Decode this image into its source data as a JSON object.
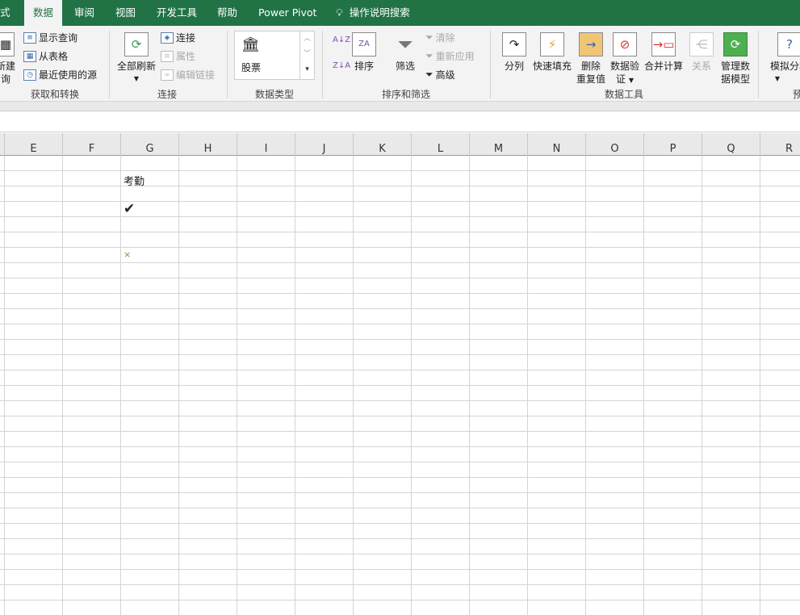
{
  "tabs": [
    {
      "label": "式"
    },
    {
      "label": "数据",
      "active": true
    },
    {
      "label": "审阅"
    },
    {
      "label": "视图"
    },
    {
      "label": "开发工具"
    },
    {
      "label": "帮助"
    },
    {
      "label": "Power Pivot"
    },
    {
      "label": "操作说明搜索",
      "icon": "lightbulb-icon"
    }
  ],
  "colors": {
    "accent": "#217346",
    "ribbon": "#f3f3f3"
  },
  "groups": {
    "get": {
      "label": "获取和转换",
      "new_query": "新建\n询",
      "show_query": "显示查询",
      "from_table": "从表格",
      "recent_sources": "最近使用的源"
    },
    "conn": {
      "label": "连接",
      "refresh_all": "全部刷新",
      "connections": "连接",
      "properties": "属性",
      "edit_links": "编辑链接"
    },
    "dtype": {
      "label": "数据类型",
      "stock": "股票"
    },
    "sort": {
      "label": "排序和筛选",
      "sort": "排序",
      "filter": "筛选",
      "clear": "清除",
      "reapply": "重新应用",
      "advanced": "高级"
    },
    "tools": {
      "label": "数据工具",
      "text_to_columns": "分列",
      "flash_fill": "快速填充",
      "remove_dup_1": "删除",
      "remove_dup_2": "重复值",
      "validation_1": "数据验",
      "validation_2": "证",
      "consolidate": "合并计算",
      "relationships": "关系",
      "data_model_1": "管理数",
      "data_model_2": "据模型"
    },
    "forecast": {
      "label": "预",
      "what_if": "模拟分析"
    }
  },
  "columns": [
    "E",
    "F",
    "G",
    "H",
    "I",
    "J",
    "K",
    "L",
    "M",
    "N",
    "O",
    "P",
    "Q",
    "R"
  ],
  "cells": {
    "g2": "考勤",
    "g4": "✔",
    "g7": "×"
  }
}
